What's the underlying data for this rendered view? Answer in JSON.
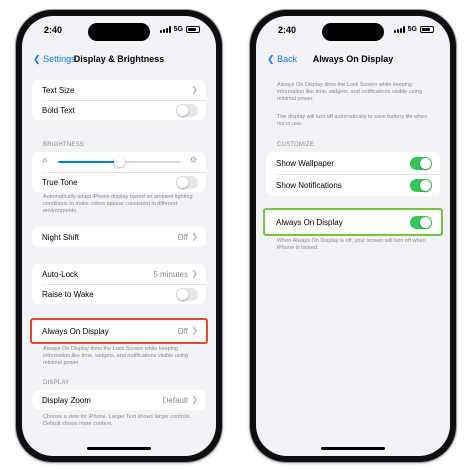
{
  "left_phone": {
    "status": {
      "time": "2:40",
      "network": "5G"
    },
    "nav": {
      "back_label": "Settings",
      "title": "Display & Brightness"
    },
    "text_group": {
      "text_size": "Text Size",
      "bold_text": "Bold Text",
      "bold_text_on": false
    },
    "brightness": {
      "header": "BRIGHTNESS",
      "level_fraction": 0.5,
      "true_tone": "True Tone",
      "true_tone_on": false,
      "footer": "Automatically adapt iPhone display based on ambient lighting conditions to make colors appear consistent in different environments."
    },
    "night_shift": {
      "label": "Night Shift",
      "value": "Off"
    },
    "lock_group": {
      "auto_lock": "Auto-Lock",
      "auto_lock_value": "5 minutes",
      "raise_to_wake": "Raise to Wake",
      "raise_to_wake_on": false
    },
    "aod": {
      "label": "Always On Display",
      "value": "Off",
      "footer": "Always On Display dims the Lock Screen while keeping information like time, widgets, and notifications visible using minimal power."
    },
    "display": {
      "header": "DISPLAY",
      "zoom_label": "Display Zoom",
      "zoom_value": "Default",
      "footer": "Choose a view for iPhone. Larger Text shows larger controls. Default shows more content."
    }
  },
  "right_phone": {
    "status": {
      "time": "2:40",
      "network": "5G"
    },
    "nav": {
      "back_label": "Back",
      "title": "Always On Display"
    },
    "intro": "Always On Display dims the Lock Screen while keeping information like time, widgets, and notifications visible using minimal power.",
    "intro2": "The display will turn off automatically to save battery life when not in use.",
    "customize": {
      "header": "CUSTOMIZE",
      "show_wallpaper": "Show Wallpaper",
      "show_wallpaper_on": true,
      "show_notifications": "Show Notifications",
      "show_notifications_on": true
    },
    "aod": {
      "label": "Always On Display",
      "on": true,
      "footer": "When Always On Display is off, your screen will turn off when iPhone is locked."
    }
  },
  "colors": {
    "accent": "#0a7aff",
    "toggle_on": "#34c759",
    "highlight_red": "#e24b2e",
    "highlight_green": "#7cc242"
  }
}
